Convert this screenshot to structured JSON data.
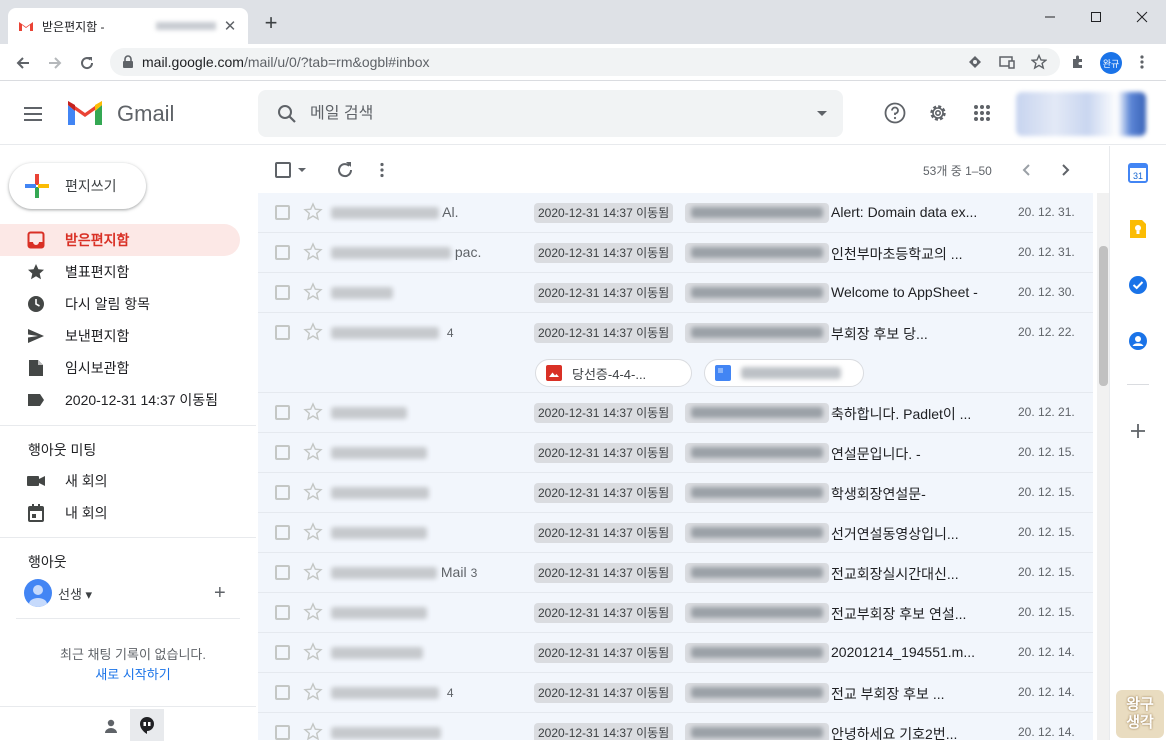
{
  "browser": {
    "tab_title": "받은편지함 - ",
    "new_tab": "+",
    "url_host": "mail.google.com",
    "url_path": "/mail/u/0/?tab=rm&ogbl#inbox",
    "profile_initials": "완규"
  },
  "gmail": {
    "product_name": "Gmail",
    "search_placeholder": "메일 검색",
    "compose_label": "편지쓰기",
    "nav": [
      {
        "label": "받은편지함",
        "icon": "inbox-icon",
        "active": true
      },
      {
        "label": "별표편지함",
        "icon": "star-icon"
      },
      {
        "label": "다시 알림 항목",
        "icon": "clock-icon"
      },
      {
        "label": "보낸편지함",
        "icon": "send-icon"
      },
      {
        "label": "임시보관함",
        "icon": "draft-icon"
      },
      {
        "label": "2020-12-31 14:37 이동됨",
        "icon": "label-icon"
      }
    ],
    "meet": {
      "title": "행아웃 미팅",
      "new_meeting": "새 회의",
      "my_meetings": "내 회의"
    },
    "hangouts": {
      "title": "행아웃",
      "user": "선생 ▾",
      "empty_text": "최근 채팅 기록이 없습니다.",
      "start_link": "새로 시작하기"
    },
    "paging": "53개 중 1–50",
    "label_chip": "2020-12-31 14:37 이동됨",
    "emails": [
      {
        "sender_suffix": "Al.",
        "count": "",
        "subject": "Alert: Domain data ex...",
        "date": "20. 12. 31."
      },
      {
        "sender_suffix": "pac.",
        "count": "",
        "subject": "인천부마초등학교의 ...",
        "date": "20. 12. 31."
      },
      {
        "sender_suffix": "",
        "count": "",
        "subject": "Welcome to AppSheet -",
        "date": "20. 12. 30."
      },
      {
        "sender_suffix": "",
        "count": "4",
        "subject": "부회장 후보 당...",
        "date": "20. 12. 22.",
        "attachment": "당선증-4-4-..."
      },
      {
        "sender_suffix": "",
        "count": "",
        "subject": "축하합니다. Padlet이 ...",
        "date": "20. 12. 21."
      },
      {
        "sender_suffix": "",
        "count": "",
        "subject": "연설문입니다. -",
        "date": "20. 12. 15."
      },
      {
        "sender_suffix": "",
        "count": "",
        "subject": "학생회장연설문-",
        "date": "20. 12. 15."
      },
      {
        "sender_suffix": "",
        "count": "",
        "subject": "선거연설동영상입니...",
        "date": "20. 12. 15."
      },
      {
        "sender_suffix": "Mail",
        "count": "3",
        "subject": "전교회장실시간대신...",
        "date": "20. 12. 15."
      },
      {
        "sender_suffix": "",
        "count": "",
        "subject": "전교부회장 후보 연설...",
        "date": "20. 12. 15."
      },
      {
        "sender_suffix": "",
        "count": "",
        "subject": "20201214_194551.m...",
        "date": "20. 12. 14."
      },
      {
        "sender_suffix": "",
        "count": "4",
        "subject": "전교 부회장 후보 ...",
        "date": "20. 12. 14."
      },
      {
        "sender_suffix": "",
        "count": "",
        "subject": "안녕하세요 기호2번...",
        "date": "20. 12. 14."
      }
    ]
  },
  "watermark": {
    "line1": "왕구",
    "line2": "생각"
  },
  "colors": {
    "gmail_red": "#d93025",
    "active_bg": "#fce8e6",
    "read_row_bg": "#f2f6fc",
    "link_blue": "#1a73e8"
  }
}
